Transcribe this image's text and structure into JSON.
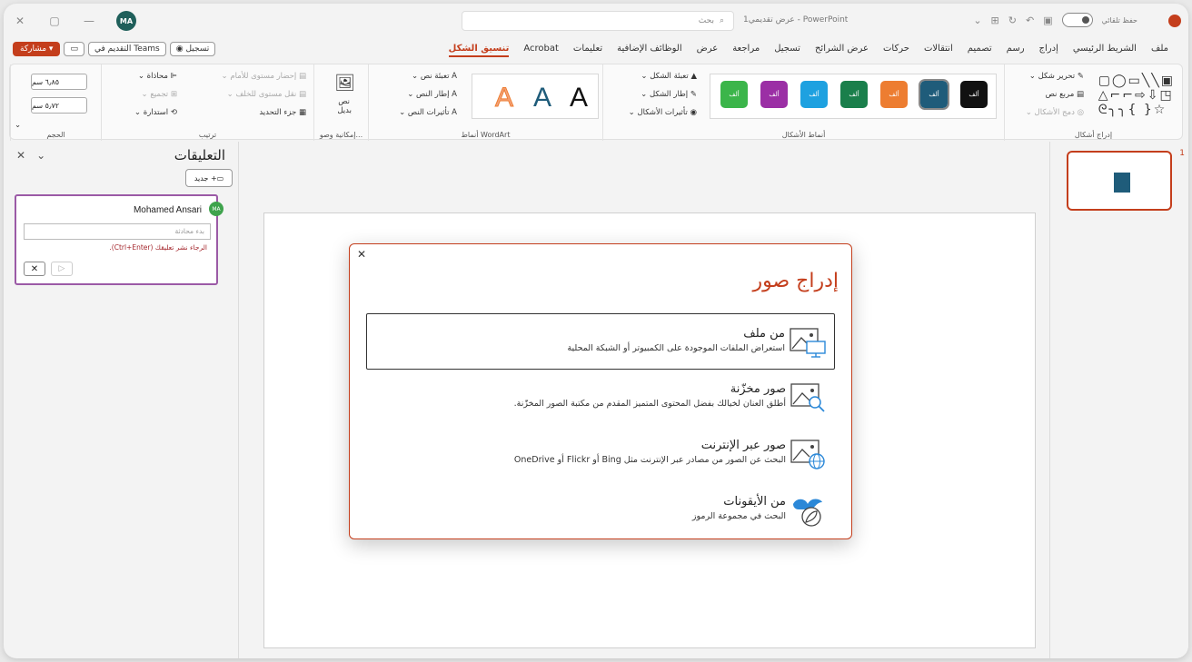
{
  "titlebar": {
    "close": "✕",
    "restore": "▢",
    "minimize": "—",
    "avatar": "MA",
    "search_placeholder": "بحث",
    "doc_title": "PowerPoint - عرض تقديمي1",
    "autosave": "حفظ تلقائي"
  },
  "tabs": [
    "ملف",
    "الشريط الرئيسي",
    "إدراج",
    "رسم",
    "تصميم",
    "انتقالات",
    "حركات",
    "عرض الشرائح",
    "تسجيل",
    "مراجعة",
    "عرض",
    "الوظائف الإضافية",
    "تعليمات",
    "Acrobat",
    "تنسيق الشكل"
  ],
  "active_tab": "تنسيق الشكل",
  "share": {
    "share_label": "مشاركة",
    "present_teams": "التقديم في Teams",
    "record": "تسجيل"
  },
  "ribbon": {
    "insert_shapes": {
      "label": "إدراج أشكال",
      "edit_shape": "تحرير شكل",
      "text_box": "مربع نص",
      "merge_shapes": "دمج الأشكال"
    },
    "shape_styles": {
      "label": "أنماط الأشكال",
      "fill": "تعبئة الشكل",
      "outline": "إطار الشكل",
      "effects": "تأثيرات الأشكال",
      "swatch_text": "ألف"
    },
    "wordart": {
      "label": "أنماط WordArt",
      "text_fill": "تعبئة نص",
      "text_outline": "إطار النص",
      "text_effects": "تأثيرات النص",
      "letter": "A"
    },
    "accessibility": {
      "label": "إمكانية وصو...",
      "alt_text_1": "نص",
      "alt_text_2": "بديل"
    },
    "arrange": {
      "label": "ترتيب",
      "bring_forward": "إحضار مستوى للأمام",
      "send_backward": "نقل مستوى للخلف",
      "selection_pane": "جزء التحديد",
      "align": "محاذاة",
      "group": "تجميع",
      "rotate": "استدارة"
    },
    "size": {
      "label": "الحجم",
      "height": "٦٫٨٥ سم",
      "width": "٥٫٧٢ سم"
    }
  },
  "colors": {
    "accent": "#c43e1c",
    "swatches": [
      "#111111",
      "#1f5c7a",
      "#ed7d31",
      "#1a7f4b",
      "#1ea1e0",
      "#9b2fa5",
      "#3bb54a"
    ]
  },
  "comments": {
    "title": "التعليقات",
    "new_button": "جديد",
    "author": "Mohamed Ansari",
    "author_initials": "MA",
    "input_placeholder": "بدء محادثة",
    "hint": "الرجاء نشر تعليقك (Ctrl+Enter).",
    "cancel": "✕",
    "send": "▷"
  },
  "thumbnail": {
    "number": "1"
  },
  "dialog": {
    "close": "✕",
    "title": "إدراج صور",
    "options": [
      {
        "title": "من ملف",
        "desc": "استعراض الملفات الموجودة على الكمبيوتر أو الشبكة المحلية"
      },
      {
        "title": "صور مخزّنة",
        "desc": "أطلق العنان لخيالك بفضل المحتوى المتميز المقدم من مكتبة الصور المخزّنة."
      },
      {
        "title": "صور عبر الإنترنت",
        "desc": "البحث عن الصور من مصادر عبر الإنترنت مثل Bing أو Flickr أو OneDrive"
      },
      {
        "title": "من الأيقونات",
        "desc": "البحث في مجموعة الرموز"
      }
    ]
  }
}
